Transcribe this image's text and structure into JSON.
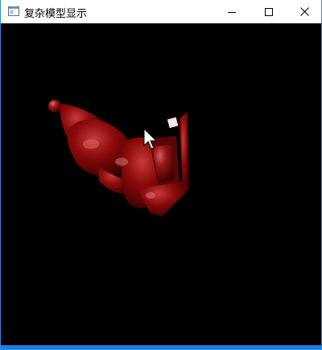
{
  "window": {
    "title": "复杂模型显示",
    "icon": "app-window-icon",
    "controls": [
      "minimize-icon",
      "maximize-icon",
      "close-icon"
    ]
  },
  "viewport": {
    "background": "#000000",
    "model_color": "#8b0a0a",
    "cursor": "arrow-cursor-icon"
  }
}
